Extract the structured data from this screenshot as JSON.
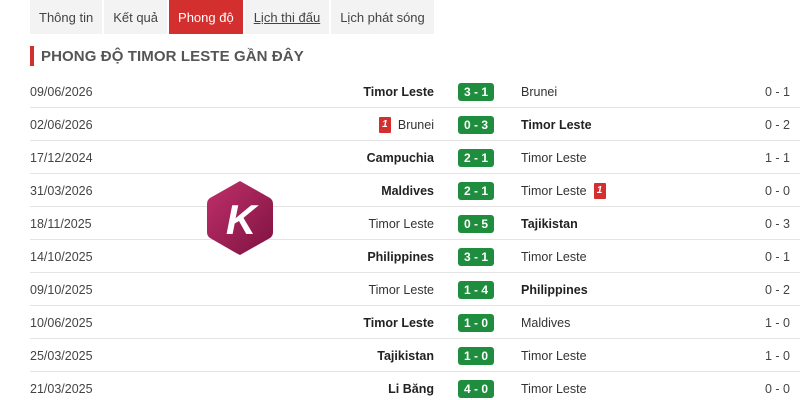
{
  "tabs": [
    {
      "label": "Thông tin",
      "active": false,
      "link": false
    },
    {
      "label": "Kết quả",
      "active": false,
      "link": false
    },
    {
      "label": "Phong độ",
      "active": true,
      "link": false
    },
    {
      "label": "Lịch thi đấu",
      "active": false,
      "link": true
    },
    {
      "label": "Lịch phát sóng",
      "active": false,
      "link": false
    }
  ],
  "section_title": "PHONG ĐỘ TIMOR LESTE GẦN ĐÂY",
  "logo": {
    "letter": "K",
    "color": "#9c1a4f"
  },
  "matches": [
    {
      "date": "09/06/2026",
      "home": "Timor Leste",
      "home_bold": true,
      "home_card": "",
      "score": "3 - 1",
      "away": "Brunei",
      "away_bold": false,
      "away_card": "",
      "ht": "0 - 1"
    },
    {
      "date": "02/06/2026",
      "home": "Brunei",
      "home_bold": false,
      "home_card": "1",
      "score": "0 - 3",
      "away": "Timor Leste",
      "away_bold": true,
      "away_card": "",
      "ht": "0 - 2"
    },
    {
      "date": "17/12/2024",
      "home": "Campuchia",
      "home_bold": true,
      "home_card": "",
      "score": "2 - 1",
      "away": "Timor Leste",
      "away_bold": false,
      "away_card": "",
      "ht": "1 - 1"
    },
    {
      "date": "31/03/2026",
      "home": "Maldives",
      "home_bold": true,
      "home_card": "",
      "score": "2 - 1",
      "away": "Timor Leste",
      "away_bold": false,
      "away_card": "1",
      "ht": "0 - 0"
    },
    {
      "date": "18/11/2025",
      "home": "Timor Leste",
      "home_bold": false,
      "home_card": "",
      "score": "0 - 5",
      "away": "Tajikistan",
      "away_bold": true,
      "away_card": "",
      "ht": "0 - 3"
    },
    {
      "date": "14/10/2025",
      "home": "Philippines",
      "home_bold": true,
      "home_card": "",
      "score": "3 - 1",
      "away": "Timor Leste",
      "away_bold": false,
      "away_card": "",
      "ht": "0 - 1"
    },
    {
      "date": "09/10/2025",
      "home": "Timor Leste",
      "home_bold": false,
      "home_card": "",
      "score": "1 - 4",
      "away": "Philippines",
      "away_bold": true,
      "away_card": "",
      "ht": "0 - 2"
    },
    {
      "date": "10/06/2025",
      "home": "Timor Leste",
      "home_bold": true,
      "home_card": "",
      "score": "1 - 0",
      "away": "Maldives",
      "away_bold": false,
      "away_card": "",
      "ht": "1 - 0"
    },
    {
      "date": "25/03/2025",
      "home": "Tajikistan",
      "home_bold": true,
      "home_card": "",
      "score": "1 - 0",
      "away": "Timor Leste",
      "away_bold": false,
      "away_card": "",
      "ht": "1 - 0"
    },
    {
      "date": "21/03/2025",
      "home": "Li Băng",
      "home_bold": true,
      "home_card": "",
      "score": "4 - 0",
      "away": "Timor Leste",
      "away_bold": false,
      "away_card": "",
      "ht": "0 - 0"
    }
  ]
}
